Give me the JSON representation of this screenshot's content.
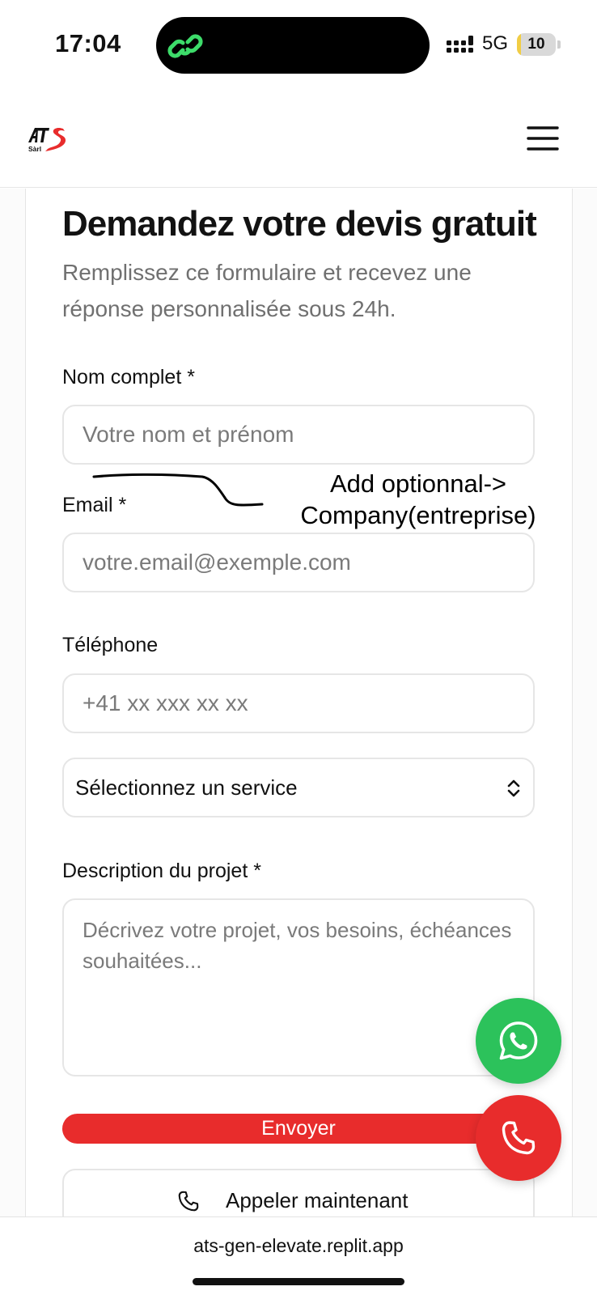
{
  "status_bar": {
    "time": "17:04",
    "network": "5G",
    "battery_level": "10",
    "battery_fraction": 0.1
  },
  "header": {
    "logo_icon": "ats-sarl-logo",
    "menu_icon": "hamburger-menu-icon"
  },
  "form": {
    "title": "Demandez votre devis gratuit",
    "subtitle": "Remplissez ce formulaire et recevez une réponse personnalisée sous 24h.",
    "name": {
      "label": "Nom complet *",
      "placeholder": "Votre nom et prénom"
    },
    "email": {
      "label": "Email *",
      "placeholder": "votre.email@exemple.com"
    },
    "phone": {
      "label": "Téléphone",
      "placeholder": "+41 xx xxx xx xx"
    },
    "service": {
      "selected": "Sélectionnez un service"
    },
    "description": {
      "label": "Description du projet *",
      "placeholder": "Décrivez votre projet, vos besoins, échéances souhaitées..."
    },
    "submit_label": "Envoyer",
    "call_label": "Appeler maintenant"
  },
  "annotation": {
    "line1": "Add optionnal->",
    "line2": "Company(entreprise)"
  },
  "floating_buttons": {
    "whatsapp_icon": "whatsapp-icon",
    "phone_icon": "phone-icon"
  },
  "browser": {
    "url": "ats-gen-elevate.replit.app"
  },
  "colors": {
    "accent_red": "#e82c2c",
    "whatsapp_green": "#2cc25b",
    "island_icon_green": "#3ddc6a"
  }
}
